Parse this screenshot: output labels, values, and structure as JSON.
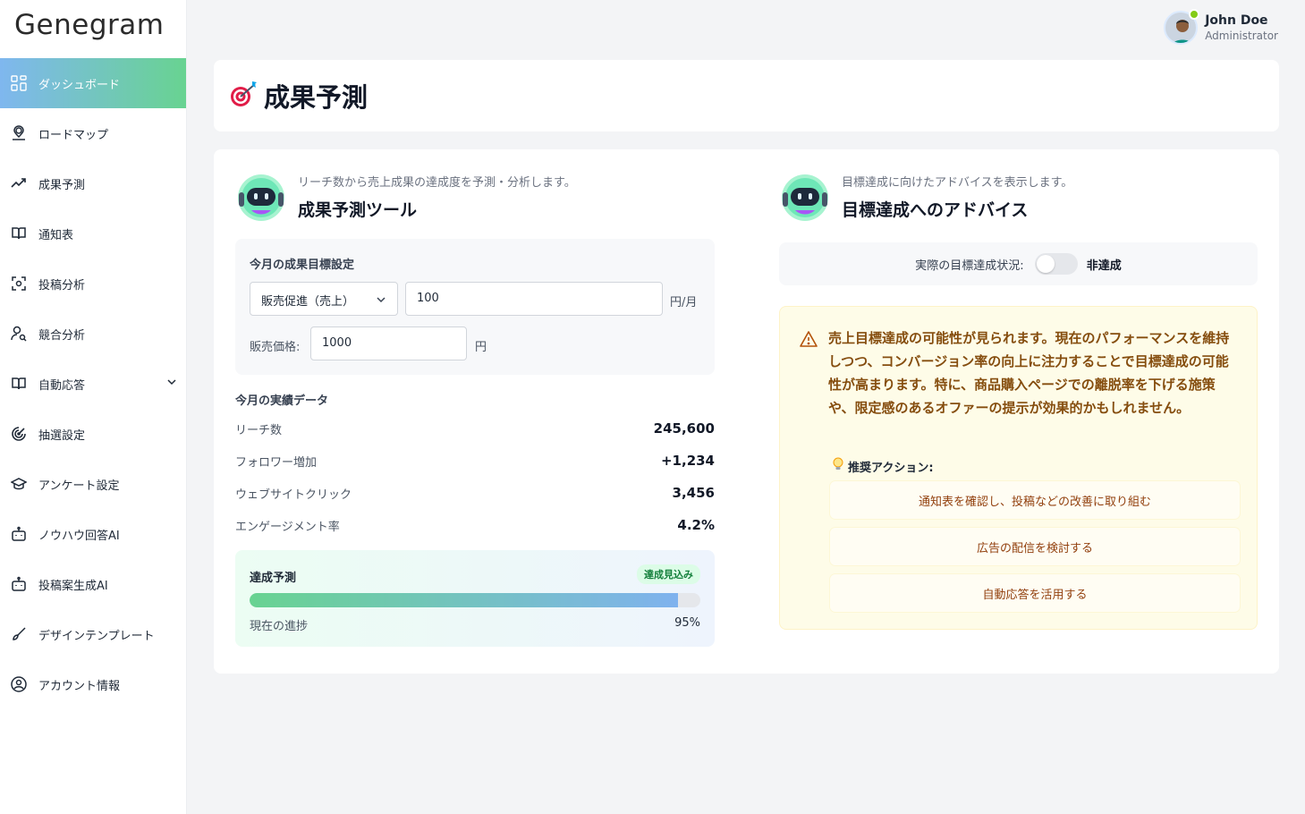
{
  "brand": {
    "logo": "Genegram"
  },
  "user": {
    "name": "John Doe",
    "role": "Administrator"
  },
  "sidebar": {
    "items": [
      {
        "label": "ダッシュボード",
        "icon": "grid-icon"
      },
      {
        "label": "ロードマップ",
        "icon": "map-pin-icon"
      },
      {
        "label": "成果予測",
        "icon": "trend-up-icon"
      },
      {
        "label": "通知表",
        "icon": "book-icon"
      },
      {
        "label": "投稿分析",
        "icon": "scan-icon"
      },
      {
        "label": "競合分析",
        "icon": "user-search-icon"
      },
      {
        "label": "自動応答",
        "icon": "book-icon"
      },
      {
        "label": "抽選設定",
        "icon": "dial-icon"
      },
      {
        "label": "アンケート設定",
        "icon": "grad-cap-icon"
      },
      {
        "label": "ノウハウ回答AI",
        "icon": "bot-icon"
      },
      {
        "label": "投稿案生成AI",
        "icon": "bot-icon"
      },
      {
        "label": "デザインテンプレート",
        "icon": "brush-icon"
      },
      {
        "label": "アカウント情報",
        "icon": "user-circle-icon"
      }
    ]
  },
  "page": {
    "title": "成果予測",
    "title_icon": "dart-target-icon"
  },
  "tool": {
    "subtitle": "リーチ数から売上成果の達成度を予測・分析します。",
    "title": "成果予測ツール",
    "goal": {
      "title": "今月の成果目標設定",
      "select_value": "販売促進（売上）",
      "target_value": "100",
      "target_unit": "円/月",
      "price_label": "販売価格:",
      "price_value": "1000",
      "price_unit": "円"
    },
    "data_title": "今月の実績データ",
    "stats": [
      {
        "label": "リーチ数",
        "value": "245,600"
      },
      {
        "label": "フォロワー増加",
        "value": "+1,234"
      },
      {
        "label": "ウェブサイトクリック",
        "value": "3,456"
      },
      {
        "label": "エンゲージメント率",
        "value": "4.2%"
      }
    ],
    "progress": {
      "title": "達成予測",
      "badge": "達成見込み",
      "footer_label": "現在の進捗",
      "value_text": "95%",
      "value": 0.95
    }
  },
  "advice": {
    "subtitle": "目標達成に向けたアドバイスを表示します。",
    "title": "目標達成へのアドバイス",
    "status_label": "実際の目標達成状況:",
    "status_value": "非達成",
    "toggle_on": false,
    "message": "売上目標達成の可能性が見られます。現在のパフォーマンスを維持しつつ、コンバージョン率の向上に注力することで目標達成の可能性が高まります。特に、商品購入ページでの離脱率を下げる施策や、限定感のあるオファーの提示が効果的かもしれません。",
    "rec_title": "推奨アクション:",
    "actions": [
      "通知表を確認し、投稿などの改善に取り組む",
      "広告の配信を検討する",
      "自動応答を活用する"
    ]
  },
  "colors": {
    "active_gradient_start": "#7fb7ef",
    "active_gradient_end": "#68d391",
    "advice_text": "#854d0e",
    "badge_green": "#15803d"
  }
}
